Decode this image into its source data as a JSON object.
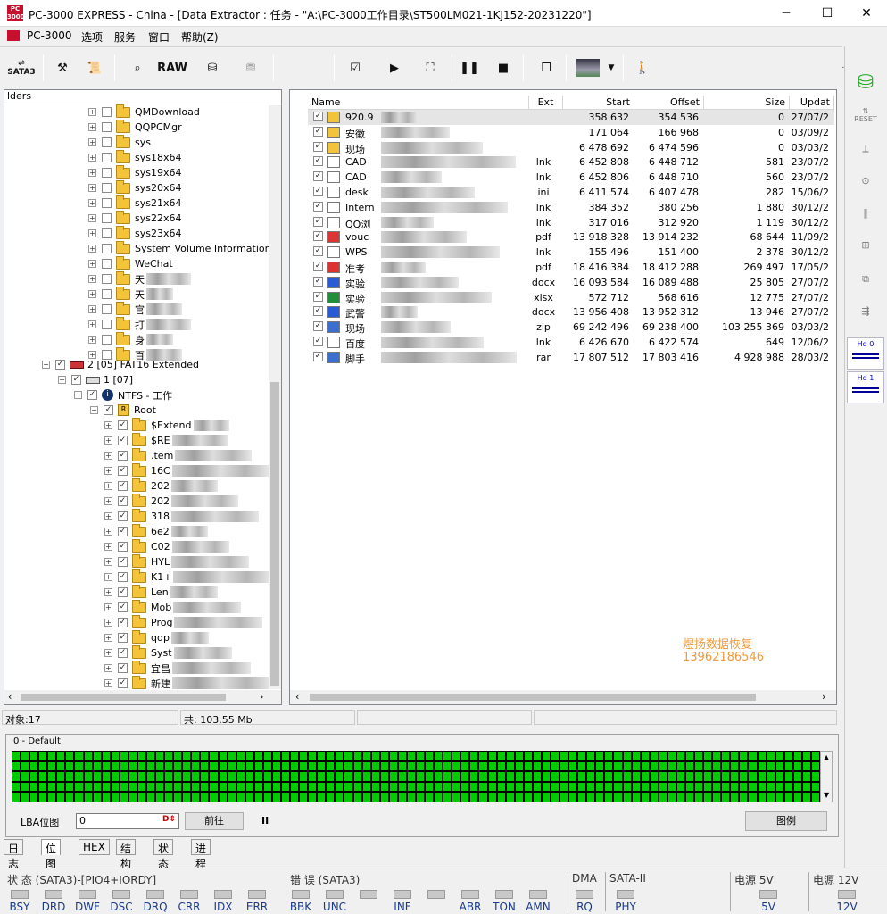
{
  "window": {
    "title": "PC-3000 EXPRESS - China - [Data Extractor : 任务 - \"A:\\PC-3000工作目录\\ST500LM021-1KJ152-20231220\"]",
    "logo": "PC 3000",
    "min": "─",
    "max": "☐",
    "close": "✕"
  },
  "menu": [
    "PC-3000",
    "选项",
    "服务",
    "窗口",
    "帮助(Z)"
  ],
  "mdi": {
    "min": "_",
    "restore": "🗗",
    "close": "✕"
  },
  "toolbar": {
    "sata": "SATA3",
    "raw": "RAW"
  },
  "left": {
    "header": "lders",
    "tree": [
      {
        "label": "QMDownload",
        "lvl": 0
      },
      {
        "label": "QQPCMgr",
        "lvl": 0
      },
      {
        "label": "sys",
        "lvl": 0
      },
      {
        "label": "sys18x64",
        "lvl": 0
      },
      {
        "label": "sys19x64",
        "lvl": 0
      },
      {
        "label": "sys20x64",
        "lvl": 0
      },
      {
        "label": "sys21x64",
        "lvl": 0
      },
      {
        "label": "sys22x64",
        "lvl": 0
      },
      {
        "label": "sys23x64",
        "lvl": 0
      },
      {
        "label": "System Volume Information",
        "lvl": 0
      },
      {
        "label": "WeChat",
        "lvl": 0
      },
      {
        "label": "天",
        "lvl": 0
      },
      {
        "label": "天",
        "lvl": 0
      },
      {
        "label": "官",
        "lvl": 0
      },
      {
        "label": "打",
        "lvl": 0
      },
      {
        "label": "身",
        "lvl": 0
      },
      {
        "label": "百",
        "lvl": 0
      }
    ],
    "partition": "2 [05] FAT16 Extended",
    "sub": "1 [07]",
    "ntfs": "NTFS - 工作",
    "root": "Root",
    "tree2": [
      "$Extend",
      "$RE",
      ".tem",
      "16C",
      "202",
      "202",
      "318",
      "6e2",
      "C02",
      "HYL",
      "K1+",
      "Len",
      "Mob",
      "Prog",
      "qqp",
      "Syst",
      "宜昌",
      "新建"
    ]
  },
  "files": {
    "headers": [
      "Name",
      "Ext",
      "Start",
      "Offset",
      "Size",
      "Updat"
    ],
    "rows": [
      [
        "920.9",
        "",
        "358 632",
        "354 536",
        "0",
        "27/07/2"
      ],
      [
        "安徽",
        "",
        "171 064",
        "166 968",
        "0",
        "03/09/2"
      ],
      [
        "现场",
        "",
        "6 478 692",
        "6 474 596",
        "0",
        "03/03/2"
      ],
      [
        "CAD",
        "lnk",
        "6 452 808",
        "6 448 712",
        "581",
        "23/07/2"
      ],
      [
        "CAD",
        "lnk",
        "6 452 806",
        "6 448 710",
        "560",
        "23/07/2"
      ],
      [
        "desk",
        "ini",
        "6 411 574",
        "6 407 478",
        "282",
        "15/06/2"
      ],
      [
        "Intern",
        "lnk",
        "384 352",
        "380 256",
        "1 880",
        "30/12/2"
      ],
      [
        "QQ浏",
        "lnk",
        "317 016",
        "312 920",
        "1 119",
        "30/12/2"
      ],
      [
        "vouc",
        "pdf",
        "13 918 328",
        "13 914 232",
        "68 644",
        "11/09/2"
      ],
      [
        "WPS",
        "lnk",
        "155 496",
        "151 400",
        "2 378",
        "30/12/2"
      ],
      [
        "准考",
        "pdf",
        "18 416 384",
        "18 412 288",
        "269 497",
        "17/05/2"
      ],
      [
        "实验",
        "docx",
        "16 093 584",
        "16 089 488",
        "25 805",
        "27/07/2"
      ],
      [
        "实验",
        "xlsx",
        "572 712",
        "568 616",
        "12 775",
        "27/07/2"
      ],
      [
        "武警",
        "docx",
        "13 956 408",
        "13 952 312",
        "13 946",
        "27/07/2"
      ],
      [
        "现场",
        "zip",
        "69 242 496",
        "69 238 400",
        "103 255 369",
        "03/03/2"
      ],
      [
        "百度",
        "lnk",
        "6 426 670",
        "6 422 574",
        "649",
        "12/06/2"
      ],
      [
        "脚手",
        "rar",
        "17 807 512",
        "17 803 416",
        "4 928 988",
        "28/03/2"
      ]
    ]
  },
  "watermark": {
    "line1": "煜扬数据恢复",
    "line2": "13962186546"
  },
  "status": {
    "objects": "对象:17",
    "total": "共: 103.55 Mb"
  },
  "map": {
    "group": "0 - Default",
    "lba_label": "LBA位图",
    "lba_value": "0",
    "goto": "前往",
    "pause": "II",
    "legend": "图例"
  },
  "tabs": [
    "日志",
    "位图",
    "HEX",
    "结构",
    "状态",
    "进程"
  ],
  "bottom": {
    "state": "状 态 (SATA3)-[PIO4+IORDY]",
    "err": "错 误 (SATA3)",
    "dma": "DMA",
    "sata2": "SATA-II",
    "p5": "电源 5V",
    "p12": "电源 12V",
    "leds1": [
      "BSY",
      "DRD",
      "DWF",
      "DSC",
      "DRQ",
      "CRR",
      "IDX",
      "ERR"
    ],
    "leds2": [
      "BBK",
      "UNC",
      "",
      "INF",
      "",
      "ABR",
      "TON",
      "AMN"
    ],
    "rq": "RQ",
    "phy": "PHY",
    "v5": "5V",
    "v12": "12V"
  },
  "rightbar": {
    "reset": "RESET",
    "hd0": "Hd 0",
    "hd1": "Hd 1"
  },
  "colors": {
    "green": "#00cc00",
    "accent": "#c8102e",
    "watermark": "#f09a3a"
  }
}
